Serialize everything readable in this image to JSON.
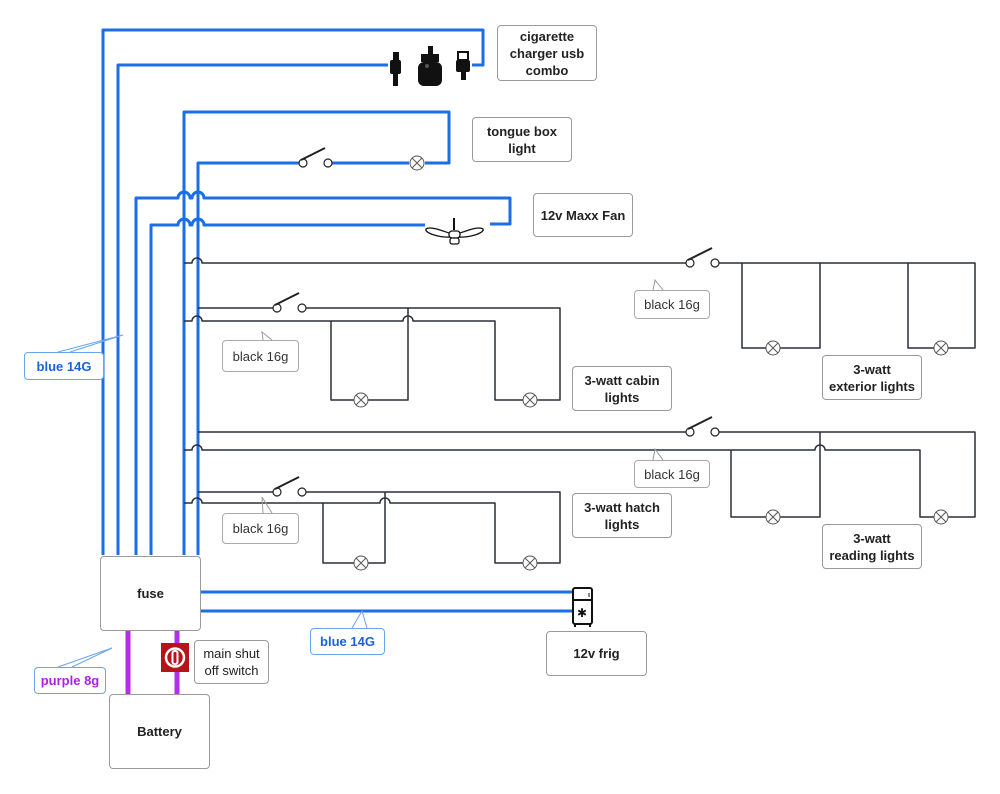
{
  "components": {
    "cigarette": "cigarette\ncharger usb\ncombo",
    "tongue_box": "tongue box\nlight",
    "fan": "12v Maxx Fan",
    "cabin": "3-watt cabin\nlights",
    "exterior": "3-watt\nexterior lights",
    "hatch": "3-watt hatch\nlights",
    "reading": "3-watt\nreading lights",
    "frig": "12v frig",
    "fuse": "fuse",
    "battery": "Battery",
    "main_switch": "main shut\noff switch"
  },
  "callouts": {
    "blue_main": "blue 14G",
    "blue_frig": "blue 14G",
    "purple": "purple 8g",
    "black_cabin": "black 16g",
    "black_exterior": "black 16g",
    "black_reading": "black 16g",
    "black_hatch": "black 16g"
  },
  "colors": {
    "blue_wire": "#1a6fe8",
    "black_wire": "#2b2f3a",
    "purple_wire": "#b52ee8",
    "switch_red": "#c0141a"
  },
  "icons": [
    "usb-plug-icon",
    "cigarette-plug-icon",
    "switch-icon",
    "lamp-icon",
    "ceiling-fan-icon",
    "refrigerator-icon",
    "power-switch-icon"
  ]
}
